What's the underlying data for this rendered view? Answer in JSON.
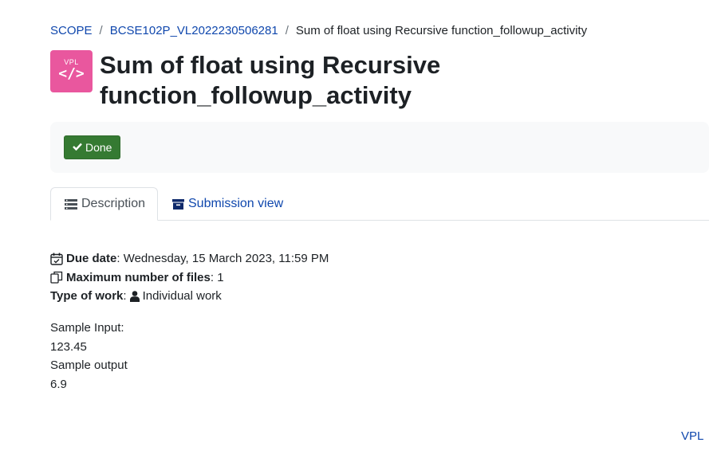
{
  "breadcrumb": {
    "items": [
      "SCOPE",
      "BCSE102P_VL2022230506281",
      "Sum of float using Recursive function_followup_activity"
    ],
    "separator": "/"
  },
  "header": {
    "icon_label": "VPL",
    "icon_glyph": "</>",
    "title": "Sum of float using Recursive function_followup_activity"
  },
  "completion": {
    "done_label": "Done",
    "color": "#357a32"
  },
  "tabs": [
    {
      "label": "Description",
      "icon": "list-icon",
      "active": true
    },
    {
      "label": "Submission view",
      "icon": "archive-icon",
      "active": false
    }
  ],
  "meta": {
    "due_label": "Due date",
    "due_value": ": Wednesday, 15 March 2023, 11:59 PM",
    "maxfiles_label": "Maximum number of files",
    "maxfiles_value": ": 1",
    "worktype_label": "Type of work",
    "worktype_sep": ":",
    "worktype_value": "Individual work"
  },
  "description": {
    "lines": [
      "Sample Input:",
      "123.45",
      "Sample output",
      "6.9"
    ]
  },
  "footer": {
    "link": "VPL"
  },
  "colors": {
    "link": "#0f47ad",
    "icon_bg": "#e9579e",
    "text": "#1d2125"
  }
}
